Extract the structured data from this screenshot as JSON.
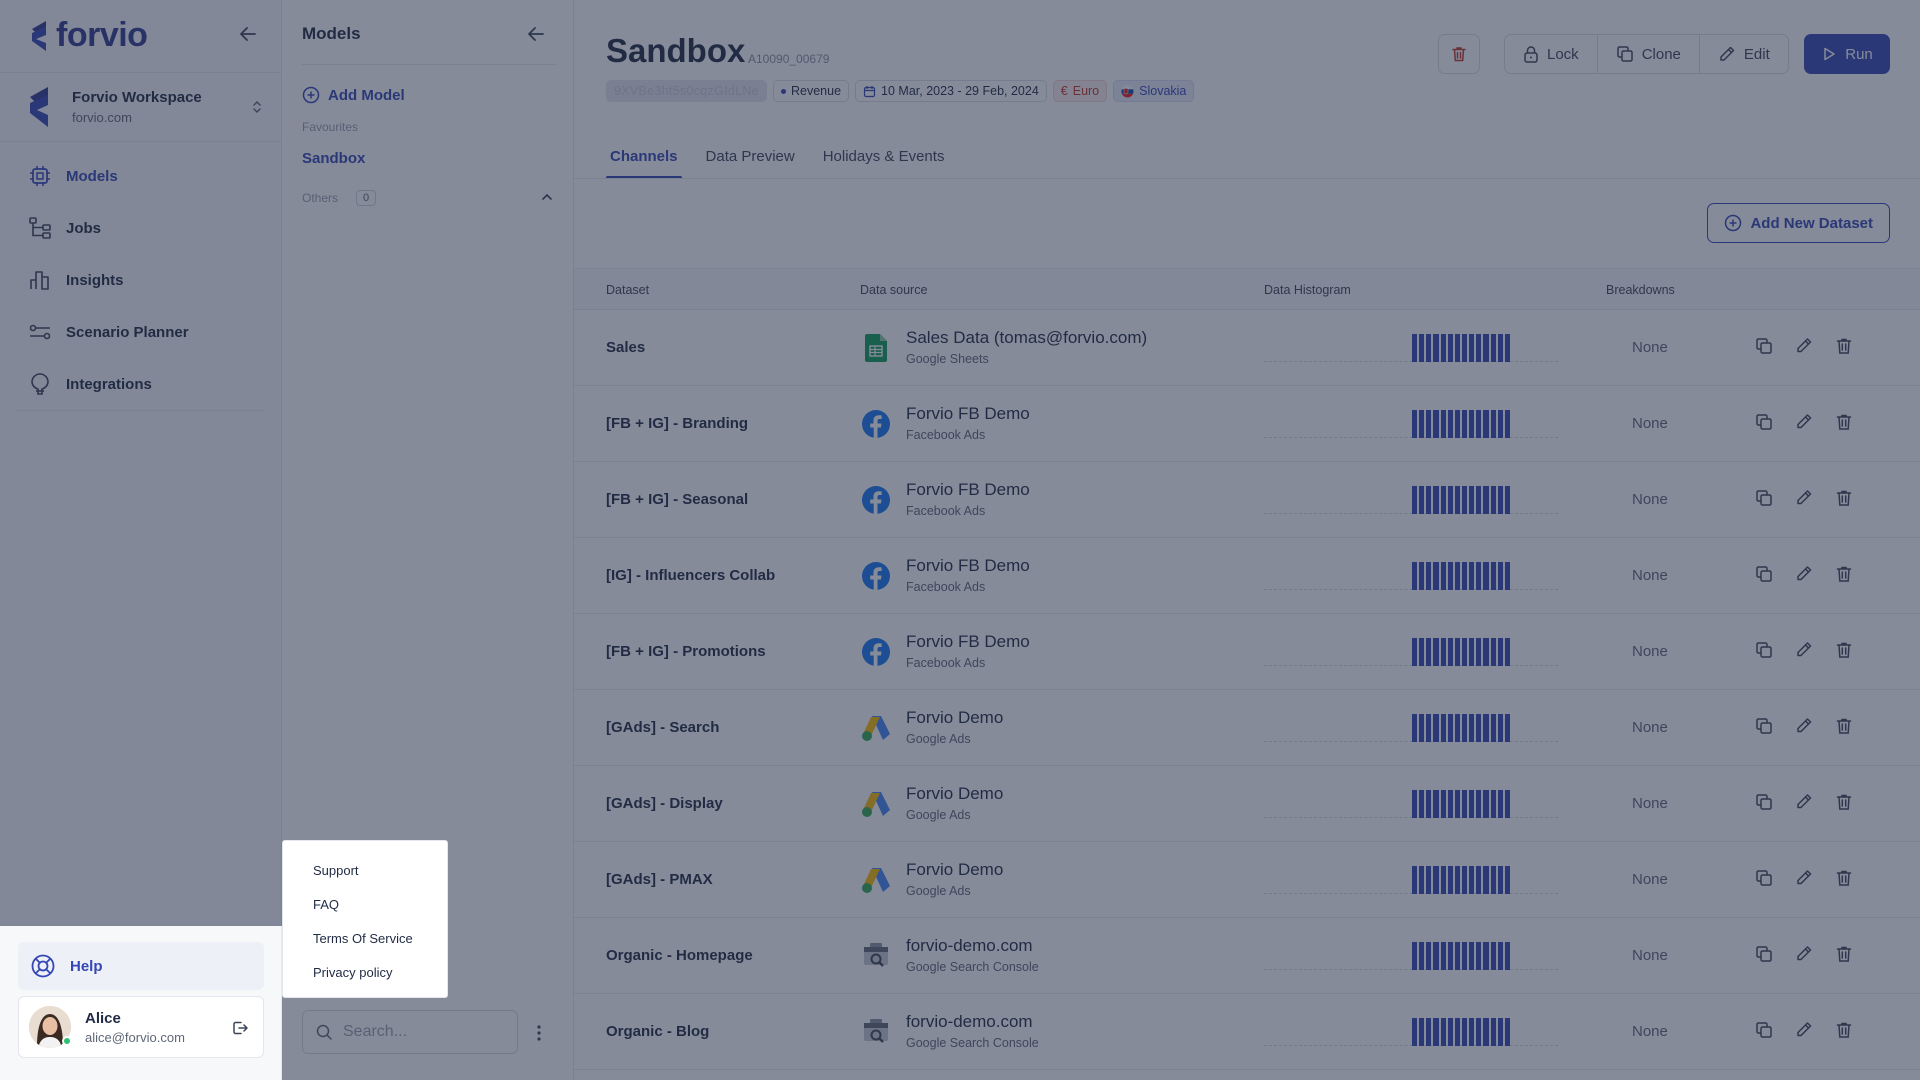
{
  "app": {
    "logo_text": "forvio"
  },
  "workspace": {
    "name": "Forvio Workspace",
    "domain": "forvio.com"
  },
  "nav": {
    "items": [
      {
        "label": "Models",
        "icon": "models-icon",
        "active": true
      },
      {
        "label": "Jobs",
        "icon": "jobs-icon"
      },
      {
        "label": "Insights",
        "icon": "insights-icon"
      },
      {
        "label": "Scenario Planner",
        "icon": "scenario-planner-icon"
      },
      {
        "label": "Integrations",
        "icon": "integrations-icon"
      }
    ],
    "help_label": "Help"
  },
  "user": {
    "name": "Alice",
    "email": "alice@forvio.com"
  },
  "models_panel": {
    "title": "Models",
    "add_label": "Add Model",
    "favourites_label": "Favourites",
    "favourite_model": "Sandbox",
    "others_label": "Others",
    "others_count": "0",
    "search_placeholder": "Search..."
  },
  "help_menu": {
    "items": [
      "Support",
      "FAQ",
      "Terms Of Service",
      "Privacy policy"
    ]
  },
  "model": {
    "title": "Sandbox",
    "id": "A10090_00679",
    "key": "9XVBe3ht5s0cqzGIdLNe",
    "kpi": "Revenue",
    "date_range": "10 Mar, 2023 - 29 Feb, 2024",
    "currency": "Euro",
    "country": "Slovakia"
  },
  "toolbar": {
    "lock_label": "Lock",
    "clone_label": "Clone",
    "edit_label": "Edit",
    "run_label": "Run"
  },
  "tabs": [
    {
      "label": "Channels",
      "active": true
    },
    {
      "label": "Data Preview"
    },
    {
      "label": "Holidays & Events"
    }
  ],
  "add_dataset_label": "Add New Dataset",
  "table": {
    "headers": {
      "dataset": "Dataset",
      "source": "Data source",
      "histogram": "Data Histogram",
      "breakdowns": "Breakdowns"
    },
    "rows": [
      {
        "dataset": "Sales",
        "source_title": "Sales Data (tomas@forvio.com)",
        "source_sub": "Google Sheets",
        "source_icon": "google-sheets",
        "breakdown": "None"
      },
      {
        "dataset": "[FB + IG] - Branding",
        "source_title": "Forvio FB Demo",
        "source_sub": "Facebook Ads",
        "source_icon": "facebook",
        "breakdown": "None"
      },
      {
        "dataset": "[FB + IG] - Seasonal",
        "source_title": "Forvio FB Demo",
        "source_sub": "Facebook Ads",
        "source_icon": "facebook",
        "breakdown": "None"
      },
      {
        "dataset": "[IG] - Influencers Collab",
        "source_title": "Forvio FB Demo",
        "source_sub": "Facebook Ads",
        "source_icon": "facebook",
        "breakdown": "None"
      },
      {
        "dataset": "[FB + IG] - Promotions",
        "source_title": "Forvio FB Demo",
        "source_sub": "Facebook Ads",
        "source_icon": "facebook",
        "breakdown": "None"
      },
      {
        "dataset": "[GAds] - Search",
        "source_title": "Forvio Demo",
        "source_sub": "Google Ads",
        "source_icon": "google-ads",
        "breakdown": "None"
      },
      {
        "dataset": "[GAds] - Display",
        "source_title": "Forvio Demo",
        "source_sub": "Google Ads",
        "source_icon": "google-ads",
        "breakdown": "None"
      },
      {
        "dataset": "[GAds] - PMAX",
        "source_title": "Forvio Demo",
        "source_sub": "Google Ads",
        "source_icon": "google-ads",
        "breakdown": "None"
      },
      {
        "dataset": "Organic - Homepage",
        "source_title": "forvio-demo.com",
        "source_sub": "Google Search Console",
        "source_icon": "google-search-console",
        "breakdown": "None"
      },
      {
        "dataset": "Organic - Blog",
        "source_title": "forvio-demo.com",
        "source_sub": "Google Search Console",
        "source_icon": "google-search-console",
        "breakdown": "None"
      }
    ]
  },
  "colors": {
    "accent": "#3447b5",
    "overlay": "#222b45",
    "facebook": "#1877f2"
  }
}
